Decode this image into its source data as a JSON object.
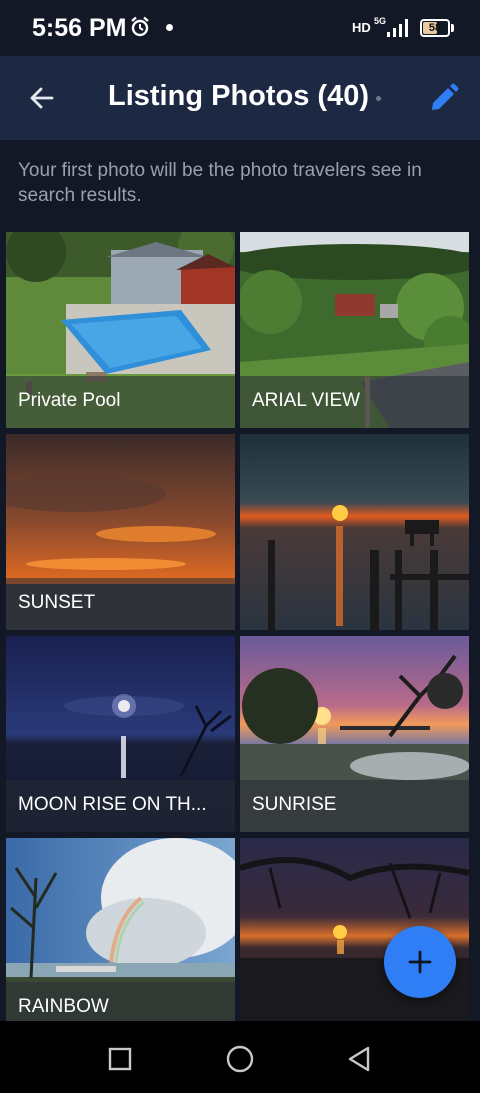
{
  "status_bar": {
    "time": "5:56 PM",
    "network": "HD",
    "network_gen": "5G",
    "battery_level": "58"
  },
  "header": {
    "title": "Listing Photos (40)",
    "back_icon": "arrow-left-icon",
    "edit_icon": "pencil-icon",
    "accent_color": "#2f7ef5"
  },
  "subtitle": "Your first photo will be the photo travelers see in search results.",
  "photos": [
    {
      "caption": "Private Pool"
    },
    {
      "caption": "ARIAL VIEW"
    },
    {
      "caption": "SUNSET"
    },
    {
      "caption": ""
    },
    {
      "caption": "MOON RISE ON TH..."
    },
    {
      "caption": "SUNRISE"
    },
    {
      "caption": "RAINBOW"
    },
    {
      "caption": ""
    }
  ],
  "fab": {
    "icon": "plus-icon"
  },
  "navigation": {
    "recents_icon": "square-icon",
    "home_icon": "circle-icon",
    "back_icon": "triangle-back-icon"
  }
}
